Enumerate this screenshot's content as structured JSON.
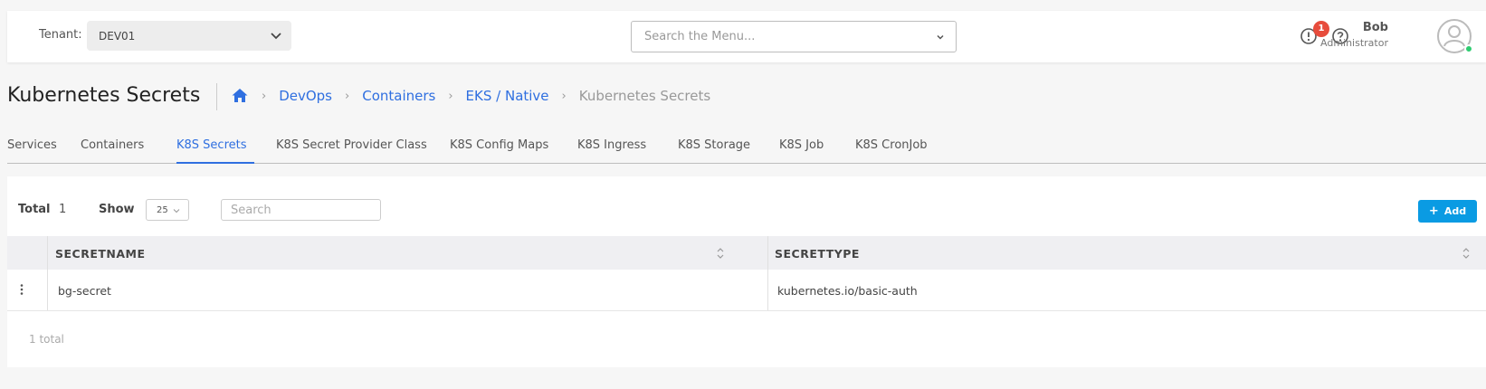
{
  "header": {
    "tenant_label": "Tenant:",
    "tenant_value": "DEV01",
    "menu_search_placeholder": "Search the Menu...",
    "alert_count": "1",
    "user_name": "Bob",
    "user_role": "Administrator",
    "online_status_color": "#2ecc71"
  },
  "page": {
    "title": "Kubernetes Secrets",
    "breadcrumb": [
      "DevOps",
      "Containers",
      "EKS / Native",
      "Kubernetes Secrets"
    ]
  },
  "tabs": [
    "Services",
    "Containers",
    "K8S Secrets",
    "K8S Secret Provider Class",
    "K8S Config Maps",
    "K8S Ingress",
    "K8S Storage",
    "K8S Job",
    "K8S CronJob"
  ],
  "active_tab": "K8S Secrets",
  "toolbar": {
    "total_label": "Total",
    "total_value": "1",
    "show_label": "Show",
    "show_value": "25",
    "search_placeholder": "Search",
    "add_label": "Add"
  },
  "table": {
    "columns": [
      "SECRETNAME",
      "SECRETTYPE"
    ],
    "rows": [
      {
        "secretname": "bg-secret",
        "secrettype": "kubernetes.io/basic-auth"
      }
    ],
    "footer": "1 total"
  },
  "colors": {
    "accent": "#2f6fe0",
    "add_button": "#0a9be3",
    "badge": "#e74c3c"
  }
}
